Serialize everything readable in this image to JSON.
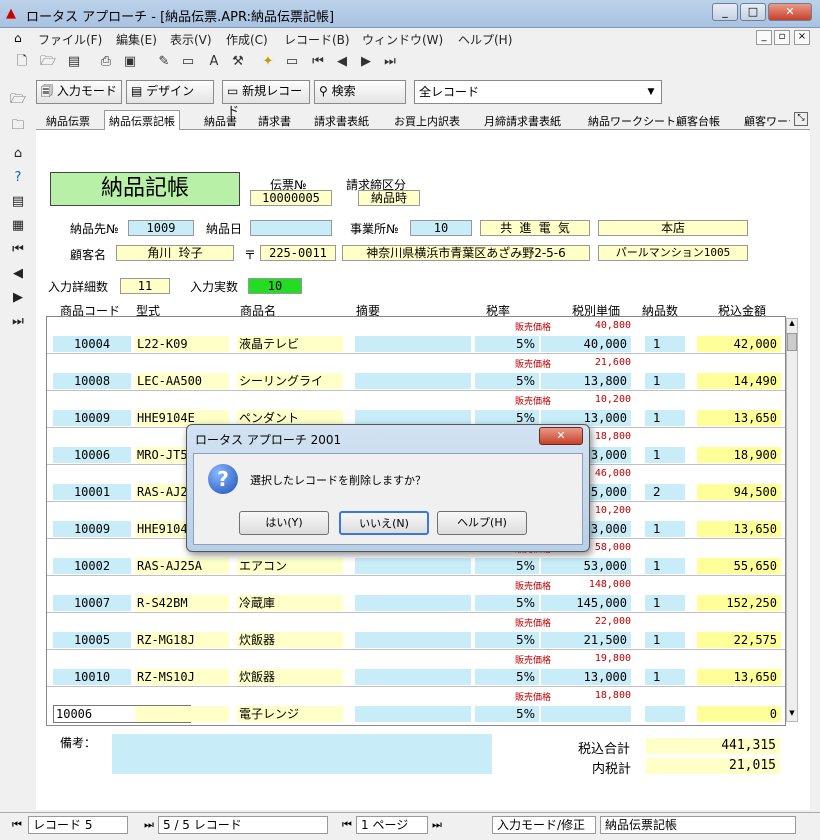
{
  "app": {
    "title": "ロータス アプローチ - [納品伝票.APR:納品伝票記帳]",
    "min": "_",
    "restore": "□",
    "close": "✕"
  },
  "menu": [
    "ファイル(F)",
    "編集(E)",
    "表示(V)",
    "作成(C)",
    "レコード(B)",
    "ウィンドウ(W)",
    "ヘルプ(H)"
  ],
  "toolbar": {
    "input_mode": "入力モード",
    "design": "デザイン",
    "new_record": "新規レコード",
    "search": "検索",
    "record_filter": "全レコード"
  },
  "tabs": [
    "納品伝票",
    "納品伝票記帳",
    "納品書",
    "請求書",
    "請求書表紙",
    "お買上内訳表",
    "月締請求書表紙",
    "納品ワークシート",
    "顧客台帳",
    "顧客ワーク"
  ],
  "form": {
    "title": "納品記帳",
    "slip_no_label": "伝票№",
    "slip_no": "10000005",
    "billing_label": "請求締区分",
    "billing": "納品時",
    "customer_no_label": "納品先№",
    "customer_no": "1009",
    "delivery_date_label": "納品日",
    "delivery_date": "",
    "office_label": "事業所№",
    "office_no": "10",
    "company": "共 進 電 気",
    "branch": "本店",
    "customer_name_label": "顧客名",
    "customer_name": "角川 玲子",
    "zip_mark": "〒",
    "zip": "225-0011",
    "address": "神奈川県横浜市青葉区あざみ野2-5-6",
    "building": "パールマンション1005",
    "detail_count_label": "入力詳細数",
    "detail_count": "11",
    "actual_count_label": "入力実数",
    "actual_count": "10"
  },
  "columns": [
    "商品コード",
    "型式",
    "商品名",
    "摘要",
    "税率",
    "税別単価",
    "納品数",
    "税込金額"
  ],
  "price_label": "販売価格",
  "rows": [
    {
      "code": "10004",
      "model": "L22-K09",
      "name": "液晶テレビ",
      "tax": "5%",
      "list": "40,800",
      "price": "40,000",
      "qty": "1",
      "amount": "42,000"
    },
    {
      "code": "10008",
      "model": "LEC-AA500",
      "name": "シーリングライ",
      "tax": "5%",
      "list": "21,600",
      "price": "13,800",
      "qty": "1",
      "amount": "14,490"
    },
    {
      "code": "10009",
      "model": "HHE9104E",
      "name": "ペンダント",
      "tax": "5%",
      "list": "10,200",
      "price": "13,000",
      "qty": "1",
      "amount": "13,650"
    },
    {
      "code": "10006",
      "model": "MRO-JT5",
      "name": "",
      "tax": "",
      "list": "18,800",
      "price": "3,000",
      "qty": "1",
      "amount": "18,900"
    },
    {
      "code": "10001",
      "model": "RAS-AJ2",
      "name": "",
      "tax": "",
      "list": "46,000",
      "price": "5,000",
      "qty": "2",
      "amount": "94,500"
    },
    {
      "code": "10009",
      "model": "HHE9104",
      "name": "",
      "tax": "",
      "list": "10,200",
      "price": "3,000",
      "qty": "1",
      "amount": "13,650"
    },
    {
      "code": "10002",
      "model": "RAS-AJ25A",
      "name": "エアコン",
      "tax": "5%",
      "list": "58,000",
      "price": "53,000",
      "qty": "1",
      "amount": "55,650"
    },
    {
      "code": "10007",
      "model": "R-S42BM",
      "name": "冷蔵庫",
      "tax": "5%",
      "list": "148,000",
      "price": "145,000",
      "qty": "1",
      "amount": "152,250"
    },
    {
      "code": "10005",
      "model": "RZ-MG18J",
      "name": "炊飯器",
      "tax": "5%",
      "list": "22,000",
      "price": "21,500",
      "qty": "1",
      "amount": "22,575"
    },
    {
      "code": "10010",
      "model": "RZ-MS10J",
      "name": "炊飯器",
      "tax": "5%",
      "list": "19,800",
      "price": "13,000",
      "qty": "1",
      "amount": "13,650"
    }
  ],
  "new_row": {
    "code": "10006",
    "name": "電子レンジ",
    "tax": "5%",
    "list": "18,800",
    "amount": "0"
  },
  "notes_label": "備考：",
  "totals": {
    "total_label": "税込合計",
    "total": "441,315",
    "tax_label": "内税計",
    "tax": "21,015"
  },
  "status": {
    "record": "レコード 5",
    "count": "5 / 5 レコード",
    "page": "1 ページ",
    "mode": "入力モード/修正",
    "form": "納品伝票記帳"
  },
  "dialog": {
    "title": "ロータス アプローチ 2001",
    "message": "選択したレコードを削除しますか？",
    "yes": "はい(Y)",
    "no": "いいえ(N)",
    "help": "ヘルプ(H)",
    "close": "✕"
  }
}
